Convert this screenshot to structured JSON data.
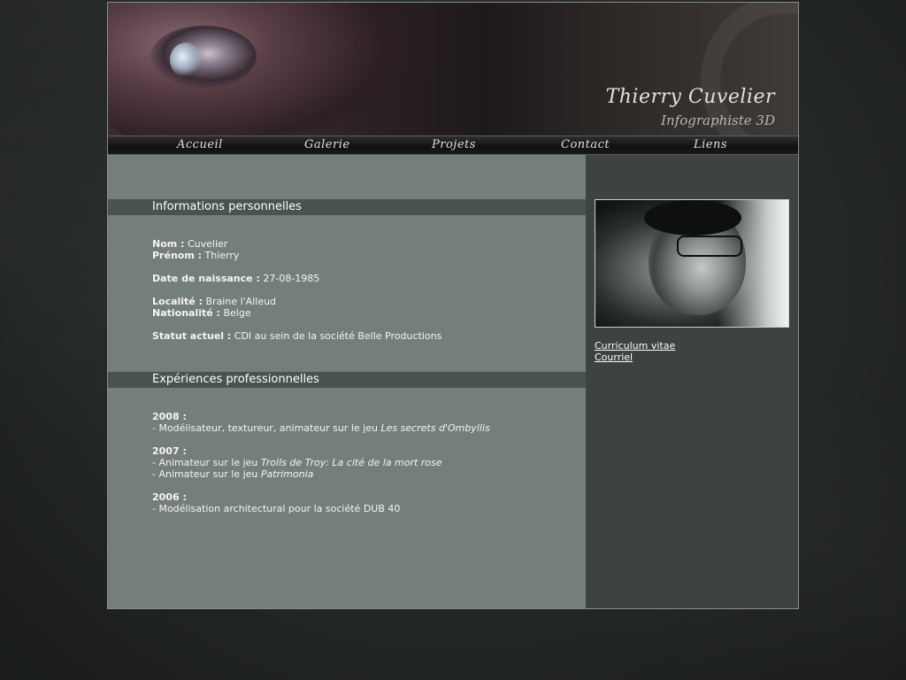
{
  "header": {
    "name": "Thierry Cuvelier",
    "role": "Infographiste 3D"
  },
  "nav": {
    "items": [
      {
        "label": "Accueil"
      },
      {
        "label": "Galerie"
      },
      {
        "label": "Projets"
      },
      {
        "label": "Contact"
      },
      {
        "label": "Liens"
      }
    ]
  },
  "personal": {
    "title": "Informations personnelles",
    "nom_label": "Nom :",
    "nom_value": "Cuvelier",
    "prenom_label": "Prénom :",
    "prenom_value": "Thierry",
    "naissance_label": "Date de naissance :",
    "naissance_value": "27-08-1985",
    "localite_label": "Localité :",
    "localite_value": "Braine l'Alleud",
    "nationalite_label": "Nationalité :",
    "nationalite_value": "Belge",
    "statut_label": "Statut actuel :",
    "statut_value": "CDI au sein de la société Belle Productions"
  },
  "experience": {
    "title": "Expériences professionnelles",
    "y2008": "2008 :",
    "y2008_line1_prefix": "- Modélisateur, textureur, animateur sur le jeu ",
    "y2008_line1_game": "Les secrets d'Ombyllis",
    "y2007": "2007 :",
    "y2007_line1_prefix": "- Animateur sur le jeu ",
    "y2007_line1_game": "Trolls de Troy: La cité de la mort rose",
    "y2007_line2_prefix": "- Animateur sur le jeu ",
    "y2007_line2_game": "Patrimonia",
    "y2006": "2006 :",
    "y2006_line1": "- Modélisation architectural pour la société DUB 40"
  },
  "sidebar": {
    "cv_link": "Curriculum vitae",
    "mail_link": "Courriel"
  }
}
